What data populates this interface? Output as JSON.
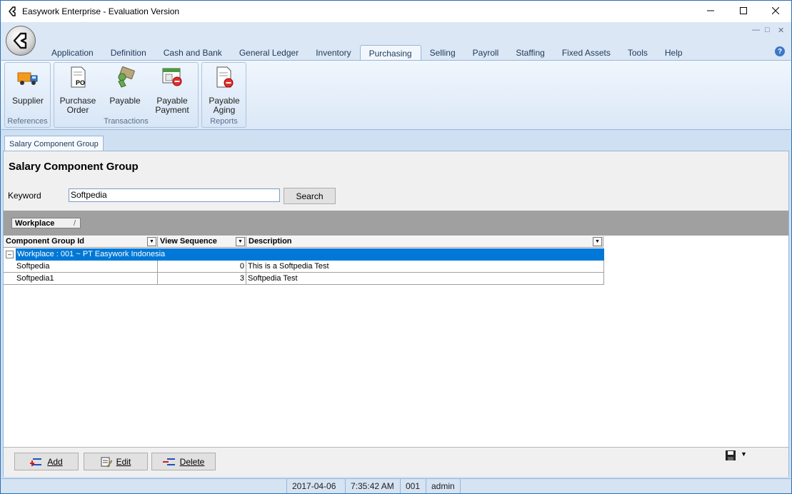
{
  "window": {
    "title": "Easywork Enterprise - Evaluation Version",
    "min_icon": "minimize-icon",
    "max_icon": "maximize-icon",
    "close_icon": "close-icon"
  },
  "ribbon": {
    "tabs": [
      {
        "label": "Application"
      },
      {
        "label": "Definition"
      },
      {
        "label": "Cash and Bank"
      },
      {
        "label": "General Ledger"
      },
      {
        "label": "Inventory"
      },
      {
        "label": "Purchasing"
      },
      {
        "label": "Selling"
      },
      {
        "label": "Payroll"
      },
      {
        "label": "Staffing"
      },
      {
        "label": "Fixed Assets"
      },
      {
        "label": "Tools"
      },
      {
        "label": "Help"
      }
    ],
    "active_tab": "Purchasing",
    "groups": {
      "references": {
        "label": "References",
        "buttons": [
          {
            "line1": "Supplier",
            "line2": "",
            "icon": "truck-icon"
          }
        ]
      },
      "transactions": {
        "label": "Transactions",
        "buttons": [
          {
            "line1": "Purchase",
            "line2": "Order",
            "icon": "purchase-order-icon"
          },
          {
            "line1": "Payable",
            "line2": "",
            "icon": "payable-icon"
          },
          {
            "line1": "Payable",
            "line2": "Payment",
            "icon": "payable-payment-icon"
          }
        ]
      },
      "reports": {
        "label": "Reports",
        "buttons": [
          {
            "line1": "Payable",
            "line2": "Aging",
            "icon": "payable-aging-icon"
          }
        ]
      }
    },
    "po_badge": "PO"
  },
  "document": {
    "tab_label": "Salary Component Group",
    "title": "Salary Component Group",
    "keyword_label": "Keyword",
    "keyword_value": "Softpedia",
    "search_label": "Search"
  },
  "grid": {
    "group_chip": "Workplace",
    "group_sort": "/",
    "columns": [
      "Component Group Id",
      "View Sequence",
      "Description"
    ],
    "group_row": "Workplace : 001 ~ PT Easywork Indonesia",
    "rows": [
      {
        "id": "Softpedia",
        "seq": "0",
        "desc": "This is a Softpedia Test"
      },
      {
        "id": "Softpedia1",
        "seq": "3",
        "desc": "Softpedia Test"
      }
    ]
  },
  "footer": {
    "add": "Add",
    "edit": "Edit",
    "delete": "Delete"
  },
  "status": {
    "date": "2017-04-06",
    "time": "7:35:42 AM",
    "code": "001",
    "user": "admin"
  },
  "colors": {
    "accent": "#0078d7",
    "ribbon": "#dbe7f5"
  }
}
